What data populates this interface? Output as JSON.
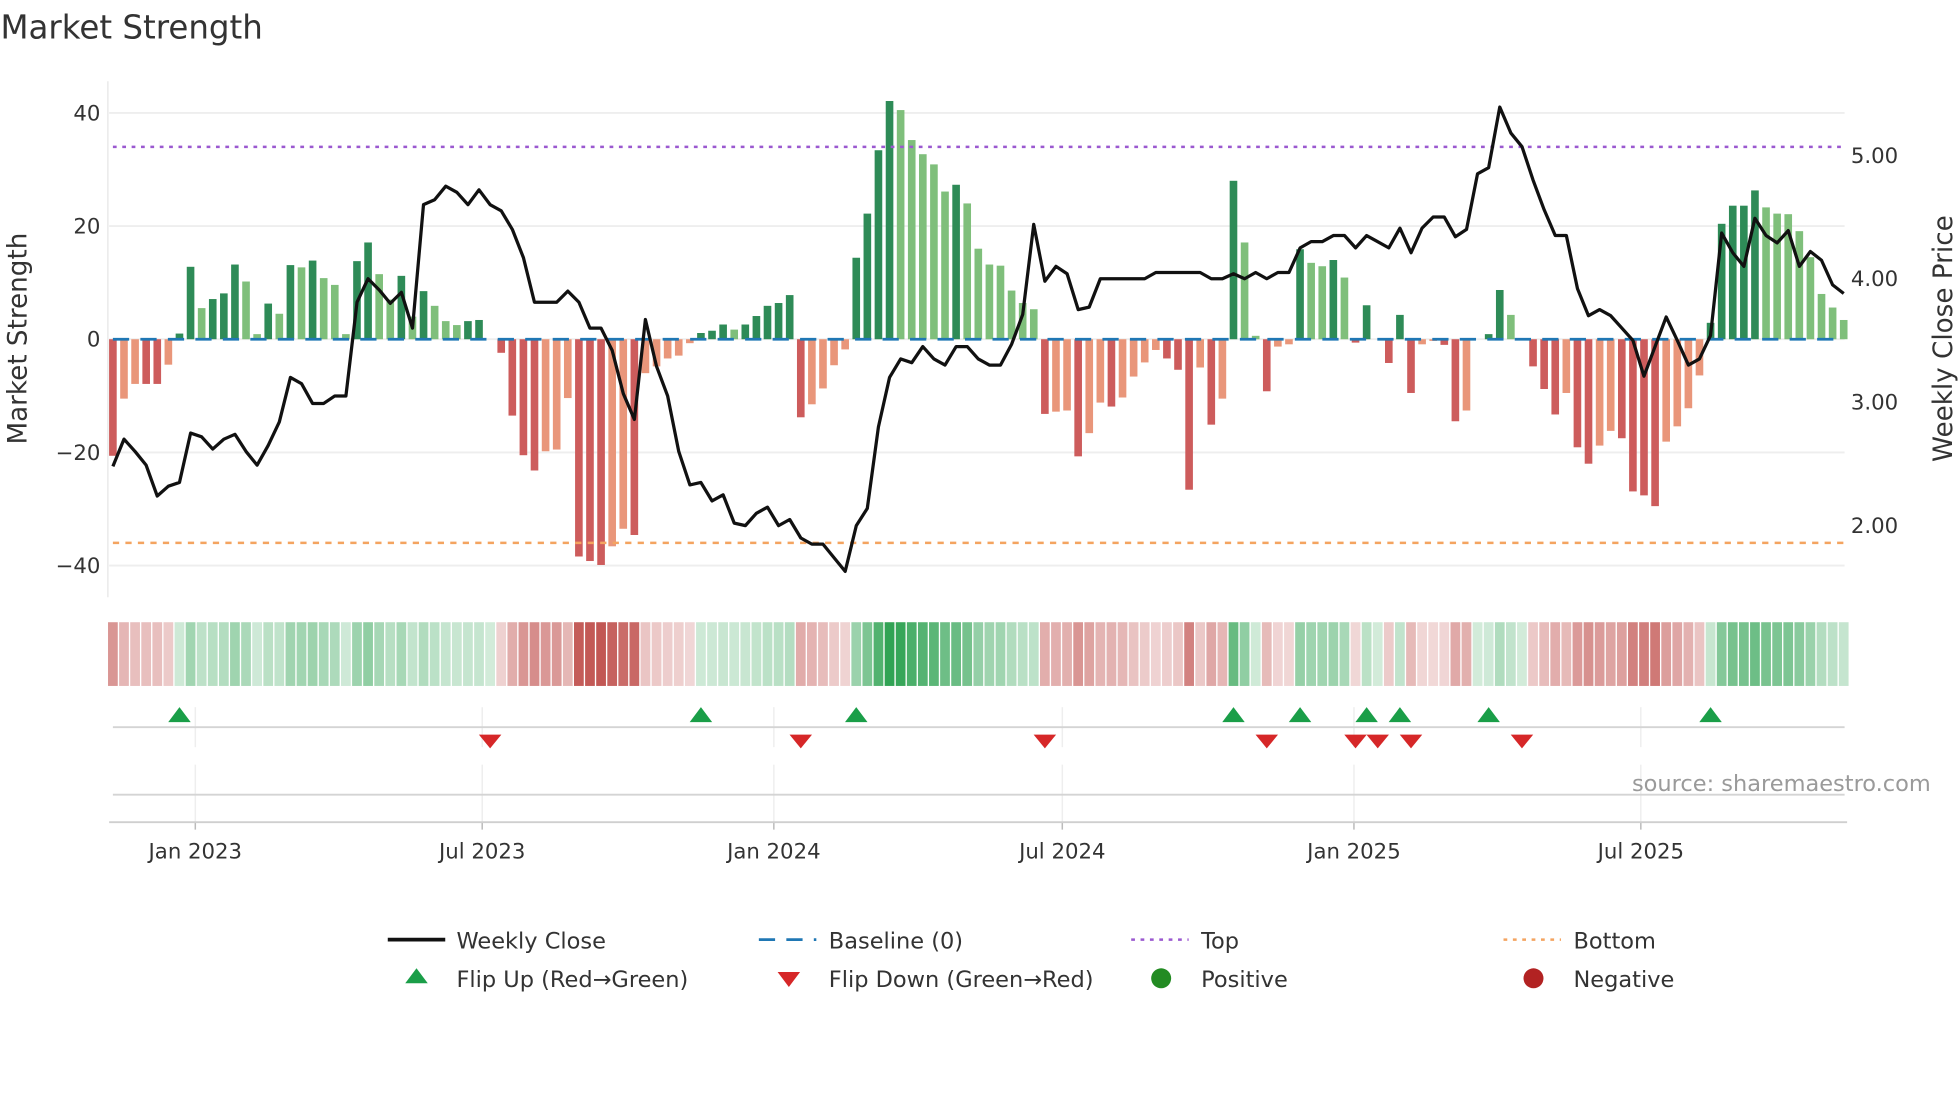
{
  "chart_data": {
    "type": "bar",
    "title": "Market Strength",
    "ylabel": "Market Strength",
    "y2label": "Weekly Close Price",
    "source": "source: sharemaestro.com",
    "start_date": "2022-11-10",
    "frequency": "weekly",
    "ylim": [
      -45.6,
      45.6
    ],
    "y2lim": [
      1.42,
      5.6
    ],
    "yticks": [
      40,
      20,
      0,
      -20,
      -40
    ],
    "ytick_labels": [
      "40",
      "20",
      "0",
      "−20",
      "−40"
    ],
    "y2ticks": [
      5.0,
      4.0,
      3.0,
      2.0
    ],
    "y2tick_labels": [
      "5.00",
      "4.00",
      "3.00",
      "2.00"
    ],
    "xticks": [
      {
        "date": "2023-01-01",
        "label": "Jan 2023"
      },
      {
        "date": "2023-07-01",
        "label": "Jul 2023"
      },
      {
        "date": "2024-01-01",
        "label": "Jan 2024"
      },
      {
        "date": "2024-07-01",
        "label": "Jul 2024"
      },
      {
        "date": "2025-01-01",
        "label": "Jan 2025"
      },
      {
        "date": "2025-07-01",
        "label": "Jul 2025"
      }
    ],
    "top_level": 34,
    "bottom_level": -36,
    "baseline": 0,
    "strength": [
      -20.6,
      -10.5,
      -7.9,
      -7.9,
      -7.9,
      -4.5,
      1.0,
      12.8,
      5.5,
      7.1,
      8.1,
      13.2,
      10.2,
      0.9,
      6.3,
      4.5,
      13.1,
      12.7,
      13.9,
      10.8,
      9.6,
      0.9,
      13.8,
      17.1,
      11.5,
      7.0,
      11.2,
      4.0,
      8.5,
      5.9,
      3.2,
      2.5,
      3.2,
      3.4,
      0,
      -2.4,
      -13.5,
      -20.5,
      -23.2,
      -19.8,
      -19.5,
      -10.4,
      -38.4,
      -39.2,
      -39.9,
      -36.6,
      -33.5,
      -34.6,
      -6.0,
      -4.8,
      -3.4,
      -2.9,
      -0.7,
      1.1,
      1.5,
      2.6,
      1.7,
      2.6,
      4.1,
      5.9,
      6.4,
      7.8,
      -13.8,
      -11.5,
      -8.7,
      -4.6,
      -1.8,
      14.4,
      22.2,
      33.4,
      42.1,
      40.5,
      35.2,
      32.7,
      30.9,
      26.1,
      27.3,
      24.0,
      16.0,
      13.2,
      13.0,
      8.6,
      6.4,
      5.3,
      -13.2,
      -12.8,
      -12.6,
      -20.7,
      -16.6,
      -11.2,
      -11.9,
      -10.3,
      -6.6,
      -4.1,
      -1.9,
      -3.4,
      -5.4,
      -26.6,
      -5.0,
      -15.1,
      -10.5,
      28.0,
      17.1,
      0.6,
      -9.2,
      -1.3,
      -0.9,
      15.9,
      13.5,
      12.9,
      14.0,
      10.9,
      -0.6,
      6.0,
      0,
      -4.2,
      4.3,
      -9.5,
      -0.9,
      -0.3,
      -1.0,
      -14.5,
      -12.6,
      0,
      0.9,
      8.7,
      4.3,
      0,
      -4.8,
      -8.8,
      -13.3,
      -9.5,
      -19.1,
      -22.0,
      -18.8,
      -16.2,
      -17.5,
      -26.9,
      -27.6,
      -29.5,
      -18.1,
      -15.4,
      -12.2,
      -6.4,
      2.9,
      20.4,
      23.6,
      23.6,
      26.3,
      23.3,
      22.2,
      22.1,
      19.1,
      14.5,
      8.0,
      5.6,
      3.4
    ],
    "weekly_close": [
      2.48,
      2.7,
      2.6,
      2.49,
      2.24,
      2.32,
      2.35,
      2.75,
      2.72,
      2.62,
      2.7,
      2.74,
      2.6,
      2.49,
      2.65,
      2.84,
      3.2,
      3.15,
      2.99,
      2.99,
      3.05,
      3.05,
      3.81,
      4.0,
      3.91,
      3.8,
      3.89,
      3.6,
      4.6,
      4.64,
      4.75,
      4.7,
      4.6,
      4.72,
      4.6,
      4.55,
      4.4,
      4.17,
      3.81,
      3.81,
      3.81,
      3.9,
      3.81,
      3.6,
      3.6,
      3.42,
      3.07,
      2.86,
      3.67,
      3.29,
      3.05,
      2.6,
      2.33,
      2.35,
      2.2,
      2.25,
      2.02,
      2.0,
      2.1,
      2.15,
      2.0,
      2.05,
      1.9,
      1.85,
      1.85,
      1.74,
      1.63,
      2.0,
      2.14,
      2.8,
      3.2,
      3.35,
      3.32,
      3.45,
      3.35,
      3.3,
      3.45,
      3.45,
      3.35,
      3.3,
      3.3,
      3.47,
      3.71,
      4.44,
      3.98,
      4.1,
      4.04,
      3.75,
      3.77,
      4.0,
      4.0,
      4.0,
      4.0,
      4.0,
      4.05,
      4.05,
      4.05,
      4.05,
      4.05,
      4.0,
      4.0,
      4.04,
      4.0,
      4.05,
      4.0,
      4.05,
      4.05,
      4.25,
      4.3,
      4.3,
      4.35,
      4.35,
      4.25,
      4.35,
      4.3,
      4.25,
      4.41,
      4.21,
      4.41,
      4.5,
      4.5,
      4.34,
      4.4,
      4.85,
      4.9,
      5.39,
      5.18,
      5.07,
      4.8,
      4.56,
      4.35,
      4.35,
      3.92,
      3.7,
      3.75,
      3.7,
      3.6,
      3.5,
      3.21,
      3.45,
      3.69,
      3.5,
      3.3,
      3.35,
      3.54,
      4.37,
      4.21,
      4.1,
      4.49,
      4.35,
      4.29,
      4.39,
      4.1,
      4.22,
      4.15,
      3.95,
      3.88
    ],
    "flip_up_weeks": [
      6,
      53,
      67,
      101,
      107,
      113,
      116,
      124,
      144
    ],
    "flip_down_weeks": [
      34,
      62,
      84,
      104,
      112,
      114,
      117,
      127
    ],
    "legend": {
      "weekly_close": "Weekly Close",
      "baseline": "Baseline (0)",
      "top": "Top",
      "bottom": "Bottom",
      "flip_up": "Flip Up (Red→Green)",
      "flip_down": "Flip Down (Green→Red)",
      "positive": "Positive",
      "negative": "Negative"
    },
    "legend_position": "bottom",
    "colors": {
      "pos_strong": "#2e8b57",
      "pos_weak": "#7fbf7b",
      "neg_strong": "#cd5c5c",
      "neg_weak": "#e9967a",
      "heat_pos": "#31a354",
      "heat_neg": "#c0504d",
      "line": "#111111",
      "baseline": "#1f77b4",
      "top": "#9b59d0",
      "bottom": "#f4a460",
      "flip_up": "#1a9e48",
      "flip_down": "#d62728",
      "positive": "#228b22",
      "negative": "#b22222"
    }
  }
}
